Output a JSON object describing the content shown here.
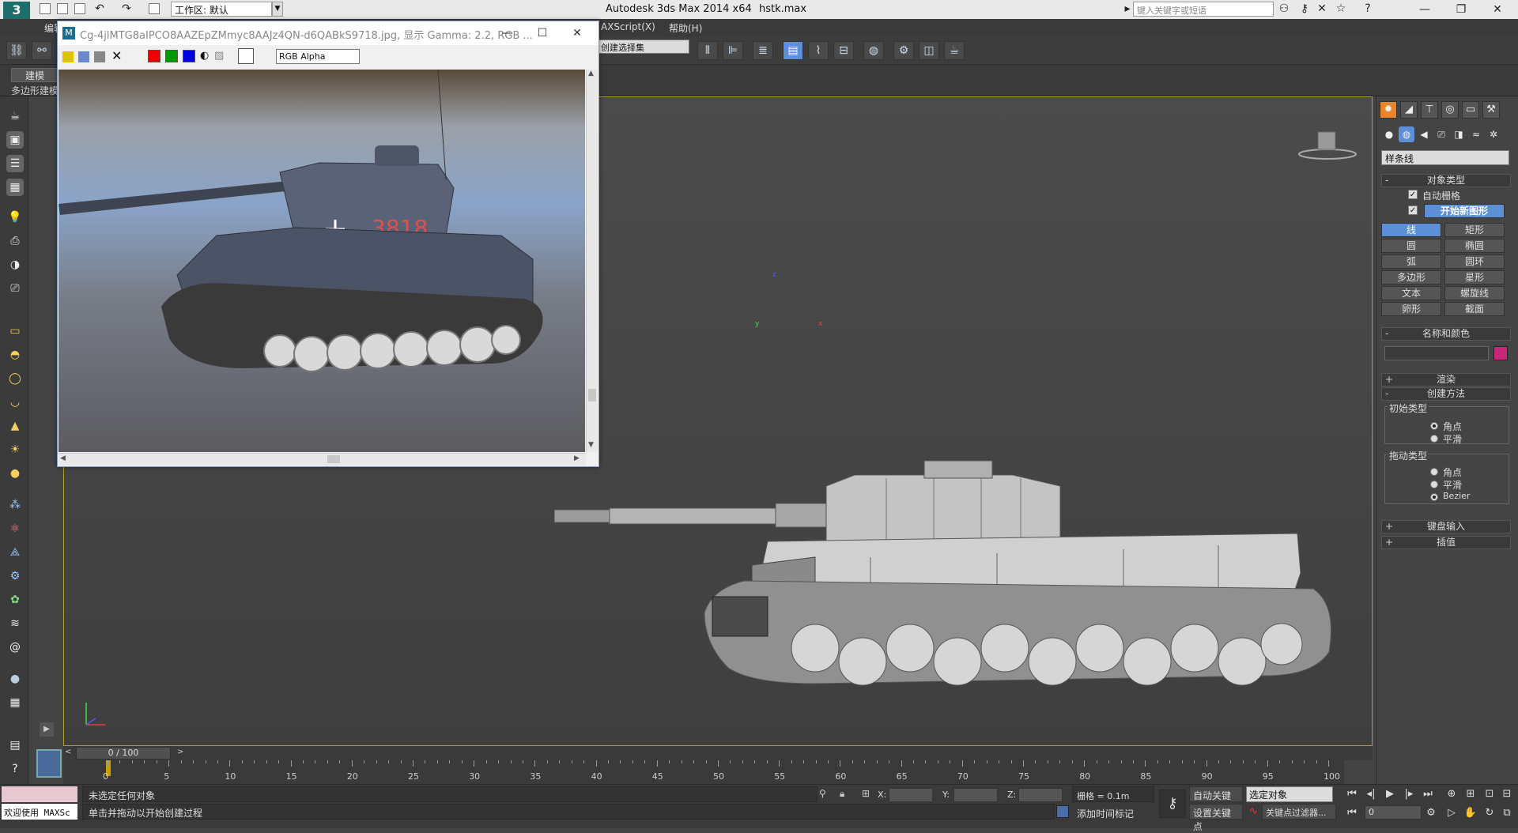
{
  "titlebar": {
    "logo": "3",
    "workspace": "工作区: 默认",
    "app_title": "Autodesk 3ds Max  2014 x64",
    "filename": "hstk.max",
    "search_placeholder": "键入关键字或短语"
  },
  "menubar": {
    "items": [
      "编辑",
      "AXScript(X)",
      "帮助(H)"
    ]
  },
  "toolbar": {
    "selection_set": "创建选择集"
  },
  "ribbon": {
    "tab_model": "建模",
    "tab_poly": "多边形建模"
  },
  "image_window": {
    "title": "Cg-4jlMTG8aIPCO8AAZEpZMmyc8AAJz4QN-d6QABkS9718.jpg, 显示 Gamma: 2.2, RGB ...",
    "channel": "RGB Alpha",
    "tank_number": "3818"
  },
  "command_panel": {
    "category": "样条线",
    "object_type": {
      "header": "对象类型",
      "auto_grid": "自动栅格",
      "start_new_shape": "开始新图形",
      "buttons": [
        "线",
        "矩形",
        "圆",
        "椭圆",
        "弧",
        "圆环",
        "多边形",
        "星形",
        "文本",
        "螺旋线",
        "卵形",
        "截面"
      ],
      "selected": "线"
    },
    "name_color": {
      "header": "名称和颜色",
      "color": "#c8287a"
    },
    "render": "渲染",
    "creation_method": {
      "header": "创建方法",
      "initial_type": "初始类型",
      "initial_options": [
        "角点",
        "平滑"
      ],
      "drag_type": "拖动类型",
      "drag_options": [
        "角点",
        "平滑",
        "Bezier"
      ]
    },
    "keyboard_entry": "键盘输入",
    "interpolation": "插值"
  },
  "timeline": {
    "frame": "0 / 100",
    "ticks": [
      "0",
      "5",
      "10",
      "15",
      "20",
      "25",
      "30",
      "35",
      "40",
      "45",
      "50",
      "55",
      "60",
      "65",
      "70",
      "75",
      "80",
      "85",
      "90",
      "95",
      "100"
    ]
  },
  "statusbar": {
    "welcome": "欢迎使用 MAXSc",
    "status1": "未选定任何对象",
    "status2": "单击并拖动以开始创建过程",
    "x_label": "X:",
    "y_label": "Y:",
    "z_label": "Z:",
    "grid": "栅格 = 0.1m",
    "add_time_tag": "添加时间标记",
    "auto_key": "自动关键点",
    "set_key": "设置关键点",
    "selected_object": "选定对象",
    "key_filters": "关键点过滤器...",
    "frame_value": "0"
  },
  "viewport": {
    "axis_x": "x",
    "axis_y": "y",
    "axis_z": "z"
  }
}
